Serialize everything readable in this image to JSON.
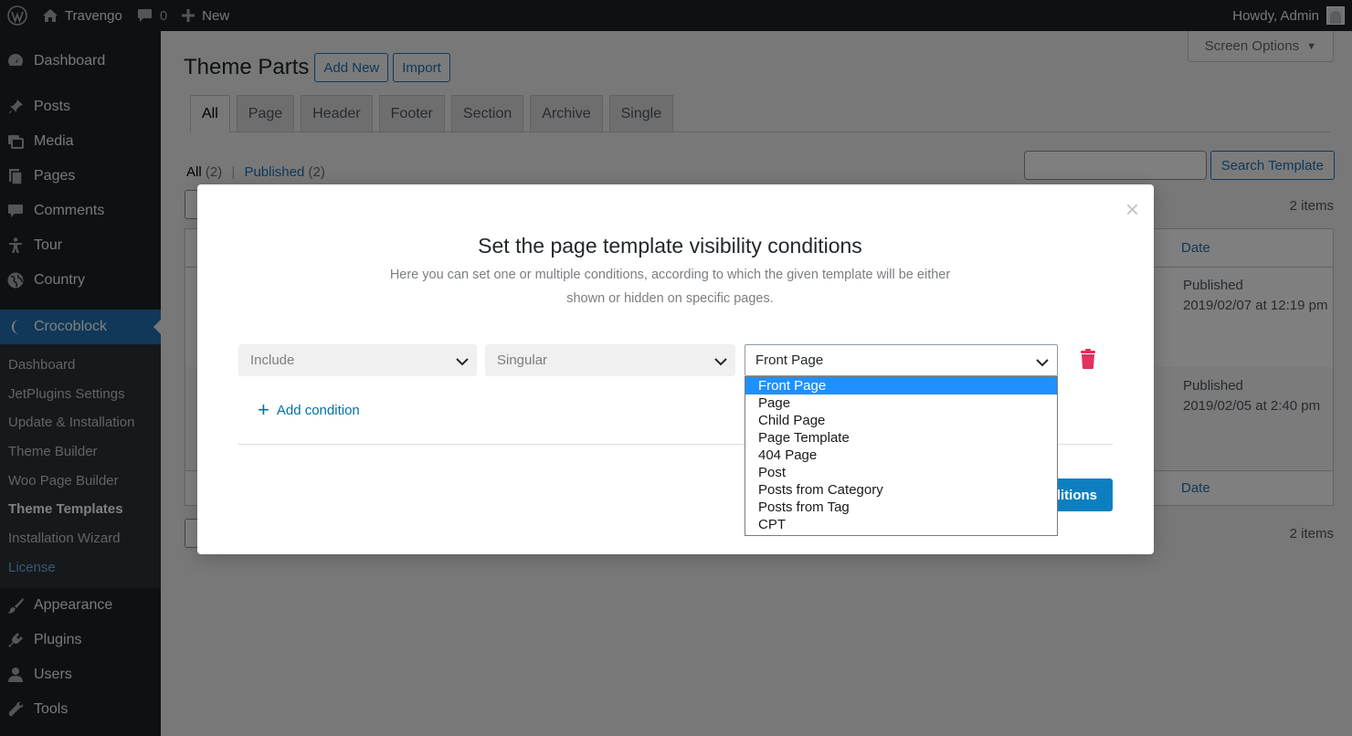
{
  "adminbar": {
    "site_name": "Travengo",
    "comments_count": "0",
    "new_label": "New",
    "howdy": "Howdy, Admin"
  },
  "sidebar": {
    "items_top": [
      {
        "label": "Dashboard",
        "icon": "dashboard-icon"
      },
      {
        "label": "Posts",
        "icon": "pin-icon"
      },
      {
        "label": "Media",
        "icon": "media-icon"
      },
      {
        "label": "Pages",
        "icon": "pages-icon"
      },
      {
        "label": "Comments",
        "icon": "comment-icon"
      },
      {
        "label": "Tour",
        "icon": "person-icon"
      },
      {
        "label": "Country",
        "icon": "globe-icon"
      }
    ],
    "current": {
      "label": "Crocoblock",
      "icon": "crocoblock-icon"
    },
    "submenu": [
      "Dashboard",
      "JetPlugins Settings",
      "Update & Installation",
      "Theme Builder",
      "Woo Page Builder",
      "Theme Templates",
      "Installation Wizard",
      "License"
    ],
    "items_bottom": [
      {
        "label": "Appearance",
        "icon": "brush-icon"
      },
      {
        "label": "Plugins",
        "icon": "plug-icon"
      },
      {
        "label": "Users",
        "icon": "user-icon"
      },
      {
        "label": "Tools",
        "icon": "wrench-icon"
      }
    ]
  },
  "page": {
    "screen_options": "Screen Options",
    "title": "Theme Parts",
    "add_new": "Add New",
    "import": "Import",
    "tabs": [
      "All",
      "Page",
      "Header",
      "Footer",
      "Section",
      "Archive",
      "Single"
    ],
    "filter_all": "All",
    "filter_all_count": "(2)",
    "filter_published": "Published",
    "filter_published_count": "(2)",
    "search_button": "Search Template",
    "items_count": "2 items",
    "col_date": "Date",
    "rows": [
      {
        "status": "Published",
        "date": "2019/02/07 at 12:19 pm"
      },
      {
        "status": "Published",
        "date": "2019/02/05 at 2:40 pm"
      }
    ]
  },
  "modal": {
    "close": "×",
    "title": "Set the page template visibility conditions",
    "desc_line1": "Here you can set one or multiple conditions, according to which the given template will be either",
    "desc_line2": "shown or hidden on specific pages.",
    "select_include": "Include",
    "select_type": "Singular",
    "select_sub": "Front Page",
    "add_condition": "Add condition",
    "save_label_visible": "nditions",
    "dropdown_options": [
      "Front Page",
      "Page",
      "Child Page",
      "Page Template",
      "404 Page",
      "Post",
      "Posts from Category",
      "Posts from Tag",
      "CPT"
    ],
    "selected_option": "Front Page"
  },
  "colors": {
    "admin_dark": "#1d2327",
    "accent_blue": "#2271b1",
    "button_blue": "#0d7fc0",
    "trash_red": "#e0315f",
    "option_selected": "#1e90ff"
  }
}
